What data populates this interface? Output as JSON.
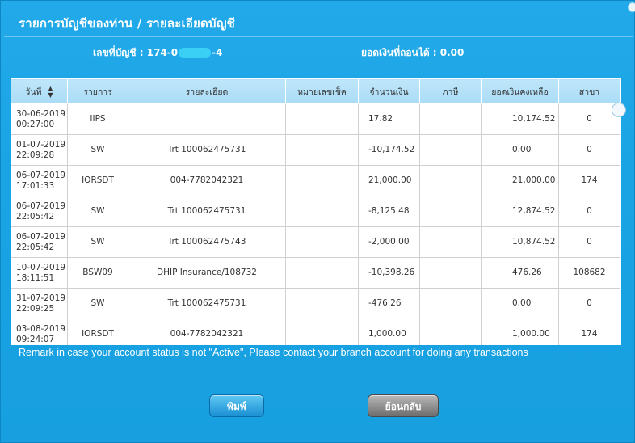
{
  "window": {
    "title": "รายการบัญชีของท่าน / รายละเอียดบัญชี"
  },
  "account": {
    "label": "เลขที่บัญชี : ",
    "number_prefix": "174-0",
    "number_suffix": "-4",
    "balance_label": "ยอดเงินที่ถอนได้ : 0.00"
  },
  "table": {
    "headers": [
      "วันที่",
      "รายการ",
      "รายละเอียด",
      "หมายเลขเช็ค",
      "จำนวนเงิน",
      "ภาษี",
      "ยอดเงินคงเหลือ",
      "สาขา"
    ],
    "rows": [
      {
        "date": "30-06-2019",
        "time": "00:27:00",
        "type": "IIPS",
        "detail": "",
        "cheque": "",
        "amount": "17.82",
        "tax": "",
        "balance": "10,174.52",
        "branch": "0"
      },
      {
        "date": "01-07-2019",
        "time": "22:09:28",
        "type": "SW",
        "detail": "Trt 100062475731",
        "cheque": "",
        "amount": "-10,174.52",
        "tax": "",
        "balance": "0.00",
        "branch": "0"
      },
      {
        "date": "06-07-2019",
        "time": "17:01:33",
        "type": "IORSDT",
        "detail": "004-7782042321",
        "cheque": "",
        "amount": "21,000.00",
        "tax": "",
        "balance": "21,000.00",
        "branch": "174"
      },
      {
        "date": "06-07-2019",
        "time": "22:05:42",
        "type": "SW",
        "detail": "Trt 100062475731",
        "cheque": "",
        "amount": "-8,125.48",
        "tax": "",
        "balance": "12,874.52",
        "branch": "0"
      },
      {
        "date": "06-07-2019",
        "time": "22:05:42",
        "type": "SW",
        "detail": "Trt 100062475743",
        "cheque": "",
        "amount": "-2,000.00",
        "tax": "",
        "balance": "10,874.52",
        "branch": "0"
      },
      {
        "date": "10-07-2019",
        "time": "18:11:51",
        "type": "BSW09",
        "detail": "DHIP Insurance/108732",
        "cheque": "",
        "amount": "-10,398.26",
        "tax": "",
        "balance": "476.26",
        "branch": "108682"
      },
      {
        "date": "31-07-2019",
        "time": "22:09:25",
        "type": "SW",
        "detail": "Trt 100062475731",
        "cheque": "",
        "amount": "-476.26",
        "tax": "",
        "balance": "0.00",
        "branch": "0"
      },
      {
        "date": "03-08-2019",
        "time": "09:24:07",
        "type": "IORSDT",
        "detail": "004-7782042321",
        "cheque": "",
        "amount": "1,000.00",
        "tax": "",
        "balance": "1,000.00",
        "branch": "174"
      }
    ]
  },
  "remark": "Remark in case your account status is not \"Active\", Please contact your branch account for doing any transactions",
  "buttons": {
    "print": "พิมพ์",
    "back": "ย้อนกลับ"
  },
  "icons": {
    "sort": "sort-updown-icon"
  },
  "colors": {
    "background": "#1ba8e6",
    "header": "#a9dcf7",
    "print_button": "#1b8fd3",
    "back_button": "#6d6d6d"
  }
}
